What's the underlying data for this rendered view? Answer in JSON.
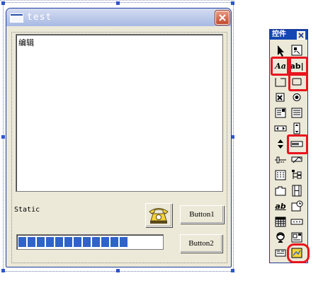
{
  "dialog": {
    "title": "test",
    "edit_text": "编辑",
    "static_label": "Static",
    "button1_label": "Button1",
    "button2_label": "Button2",
    "progress_segments_filled": 12,
    "progress_percent": 70
  },
  "toolbox": {
    "title": "控件",
    "text_tool_label": "Aa",
    "edit_tool_label": "ab|",
    "rich_edit_label": "ab",
    "tools": [
      "pointer-tool",
      "picture-tool",
      "static-text-tool",
      "edit-box-tool",
      "group-box-tool",
      "button-tool",
      "check-box-tool",
      "radio-button-tool",
      "combo-box-tool",
      "list-box-tool",
      "horizontal-scrollbar-tool",
      "vertical-scrollbar-tool",
      "spin-tool",
      "progress-tool",
      "slider-tool",
      "hot-key-tool",
      "list-control-tool",
      "tree-control-tool",
      "tab-control-tool",
      "animate-tool",
      "rich-edit-tool",
      "date-time-picker-tool",
      "month-calendar-tool",
      "ip-address-tool",
      "custom-control-tool",
      "extended-combo-tool",
      "syslink-tool",
      "picture-control-tool"
    ]
  },
  "colors": {
    "selection_highlight": "#e8141e",
    "progress_fill": "#2f63c9",
    "toolbox_title": "#1547b4"
  }
}
